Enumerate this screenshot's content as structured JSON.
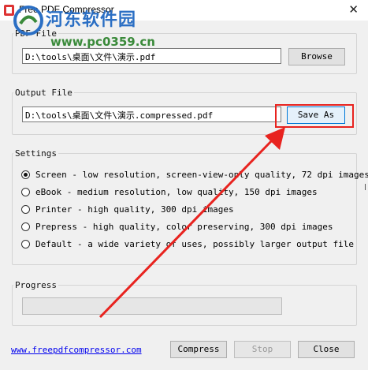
{
  "window": {
    "title": "Free PDF Compressor",
    "close_glyph": "✕"
  },
  "watermark": {
    "title": "河东软件园",
    "url": "www.pc0359.cn"
  },
  "pdf_file": {
    "label": "PDF File",
    "value": "D:\\tools\\桌面\\文件\\演示.pdf",
    "browse_label": "Browse"
  },
  "output_file": {
    "label": "Output File",
    "value": "D:\\tools\\桌面\\文件\\演示.compressed.pdf",
    "save_as_label": "Save As"
  },
  "settings": {
    "label": "Settings",
    "options": [
      {
        "label": "Screen - low resolution, screen-view-only quality, 72 dpi images",
        "checked": true
      },
      {
        "label": "eBook - medium resolution, low quality, 150 dpi images",
        "checked": false
      },
      {
        "label": "Printer - high quality, 300 dpi images",
        "checked": false
      },
      {
        "label": "Prepress - high quality, color preserving, 300 dpi images",
        "checked": false
      },
      {
        "label": "Default - a wide variety of uses, possibly larger output file",
        "checked": false
      }
    ]
  },
  "progress": {
    "label": "Progress",
    "value": 0
  },
  "footer": {
    "link": "www.freepdfcompressor.com",
    "compress_label": "Compress",
    "stop_label": "Stop",
    "close_label": "Close"
  },
  "colors": {
    "annotation": "#e8231f",
    "link": "#0000ee"
  }
}
